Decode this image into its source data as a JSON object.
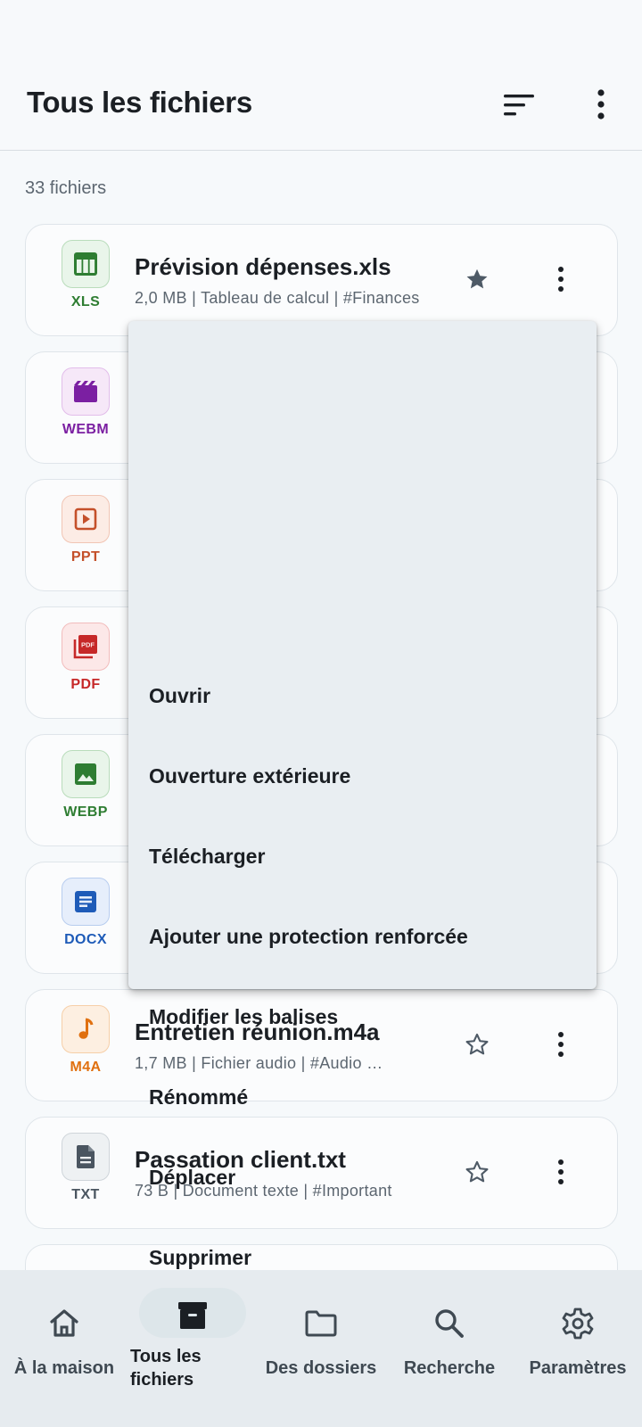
{
  "header": {
    "title": "Tous les fichiers"
  },
  "file_count": "33 fichiers",
  "files": [
    {
      "name": "Prévision dépenses.xls",
      "meta": "2,0 MB | Tableau de calcul | #Finances",
      "ext": "XLS",
      "starred": true
    },
    {
      "ext": "WEBM"
    },
    {
      "ext": "PPT"
    },
    {
      "ext": "PDF"
    },
    {
      "ext": "WEBP"
    },
    {
      "ext": "DOCX"
    },
    {
      "name": "Entretien réunion.m4a",
      "meta": "1,7 MB | Fichier audio | #Audio  …",
      "ext": "M4A",
      "starred": false
    },
    {
      "name": "Passation client.txt",
      "meta": "73 B | Document texte | #Important",
      "ext": "TXT",
      "starred": false
    }
  ],
  "menu": {
    "items": [
      "Ouvrir",
      "Ouverture extérieure",
      "Télécharger",
      "Ajouter une protection renforcée",
      "Modifier les balises",
      "Rénommé",
      "Déplacer",
      "Supprimer"
    ]
  },
  "nav": {
    "items": [
      {
        "label": "À la maison",
        "icon": "home-icon"
      },
      {
        "label": "Tous les fichiers",
        "icon": "archive-icon",
        "active": true
      },
      {
        "label": "Des dossiers",
        "icon": "folder-icon"
      },
      {
        "label": "Recherche",
        "icon": "search-icon"
      },
      {
        "label": "Paramètres",
        "icon": "gear-icon"
      }
    ]
  },
  "colors": {
    "xls": "#2e7d32",
    "webm": "#7b1fa2",
    "ppt": "#c4502a",
    "pdf": "#c62828",
    "webp": "#2e7d32",
    "docx": "#1e5bb8",
    "m4a": "#e0700f",
    "txt": "#4a5560"
  }
}
